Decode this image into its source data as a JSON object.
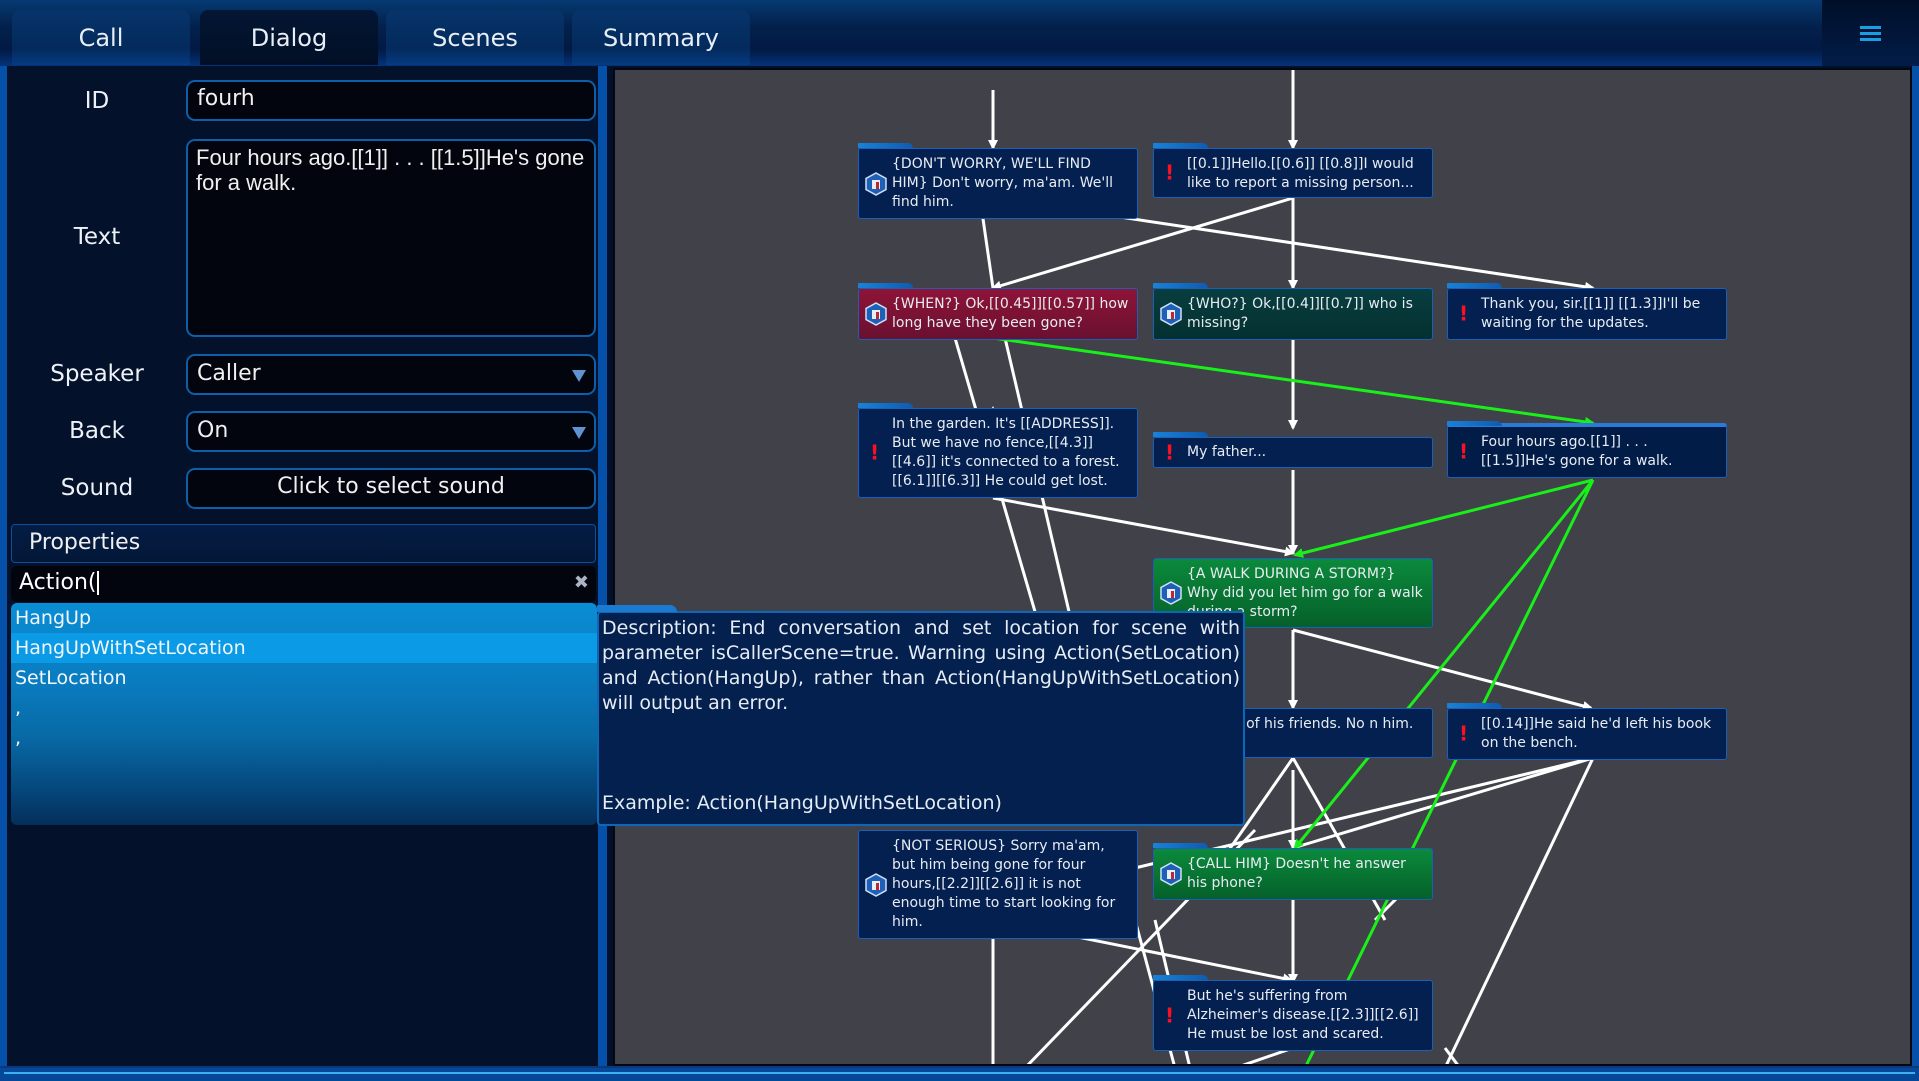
{
  "tabs": [
    {
      "label": "Call",
      "active": false
    },
    {
      "label": "Dialog",
      "active": true
    },
    {
      "label": "Scenes",
      "active": false
    },
    {
      "label": "Summary",
      "active": false
    }
  ],
  "menu_icon": "hamburger-menu-icon",
  "form": {
    "id_label": "ID",
    "id_value": "fourh",
    "text_label": "Text",
    "text_value": "Four hours ago.[[1]] . . . [[1.5]]He's gone for a walk.",
    "speaker_label": "Speaker",
    "speaker_value": "Caller",
    "back_label": "Back",
    "back_value": "On",
    "sound_label": "Sound",
    "sound_button": "Click to select sound"
  },
  "properties": {
    "header": "Properties",
    "input_value": "Action(",
    "clear_icon": "clear-x-icon",
    "suggestions": [
      "HangUp",
      "HangUpWithSetLocation",
      "SetLocation",
      ",",
      ","
    ],
    "selected_index": 1
  },
  "tooltip": {
    "description": "Description: End conversation and set location for scene with parameter isCallerScene=true. Warning using Action(SetLocation) and Action(HangUp), rather than Action(HangUpWithSetLocation) will output an error.",
    "example": "Example: Action(HangUpWithSetLocation)"
  },
  "graph": {
    "colors": {
      "edge": "#ffffff",
      "active_edge": "#19f019",
      "warning": "#ff1020"
    },
    "nodes": [
      {
        "id": "dont-worry",
        "text": "{DON'T WORRY, WE'LL FIND HIM} Don't worry, ma'am. We'll find him.",
        "speaker": "operator",
        "style": "default"
      },
      {
        "id": "hello",
        "text": "[[0.1]]Hello.[[0.6]] [[0.8]]I would like to report a missing person...",
        "speaker": "caller",
        "style": "default"
      },
      {
        "id": "when",
        "text": "{WHEN?} Ok,[[0.45]][[0.57]] how long have they been gone?",
        "speaker": "operator",
        "style": "red"
      },
      {
        "id": "who",
        "text": "{WHO?} Ok,[[0.4]][[0.7]] who is missing?",
        "speaker": "operator",
        "style": "teal"
      },
      {
        "id": "thank-you",
        "text": "Thank you, sir.[[1]] [[1.3]]I'll be waiting for the updates.",
        "speaker": "caller",
        "style": "default"
      },
      {
        "id": "garden",
        "text": "In the garden. It's [[ADDRESS]]. But we have no fence,[[4.3]][[4.6]] it's connected to a forest.[[6.1]][[6.3]] He could get lost.",
        "speaker": "caller",
        "style": "default"
      },
      {
        "id": "my-father",
        "text": "My father...",
        "speaker": "caller",
        "style": "default"
      },
      {
        "id": "fourh",
        "text": "Four hours ago.[[1]] . . . [[1.5]]He's gone for a walk.",
        "speaker": "caller",
        "style": "selected"
      },
      {
        "id": "storm",
        "text": "{A WALK DURING A STORM?} Why did you let him go for a walk during a storm?",
        "speaker": "operator",
        "style": "green"
      },
      {
        "id": "friends",
        "text": "alled all of his friends. No n him.",
        "speaker": "caller",
        "style": "default"
      },
      {
        "id": "book",
        "text": "[[0.14]]He said he'd left his book on the bench.",
        "speaker": "caller",
        "style": "default"
      },
      {
        "id": "not-serious",
        "text": "{NOT SERIOUS} Sorry ma'am, but him being gone for four hours,[[2.2]][[2.6]] it is not enough time to start looking for him.",
        "speaker": "operator",
        "style": "default"
      },
      {
        "id": "call-him",
        "text": "{CALL HIM} Doesn't he answer his phone?",
        "speaker": "operator",
        "style": "green"
      },
      {
        "id": "alzheimer",
        "text": "But he's suffering from Alzheimer's disease.[[2.3]][[2.6]] He must be lost and scared.",
        "speaker": "caller",
        "style": "default"
      }
    ]
  }
}
